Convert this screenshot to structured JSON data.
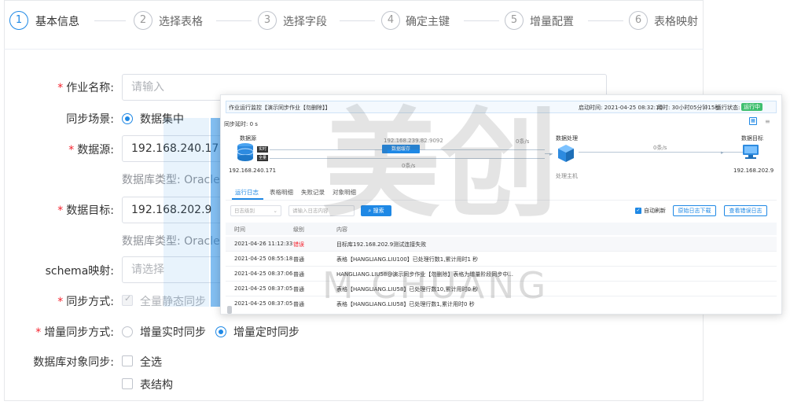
{
  "steps": [
    {
      "num": "1",
      "label": "基本信息"
    },
    {
      "num": "2",
      "label": "选择表格"
    },
    {
      "num": "3",
      "label": "选择字段"
    },
    {
      "num": "4",
      "label": "确定主键"
    },
    {
      "num": "5",
      "label": "增量配置"
    },
    {
      "num": "6",
      "label": "表格映射"
    }
  ],
  "form": {
    "job_name": {
      "label": "作业名称:",
      "placeholder": "请输入"
    },
    "scene": {
      "label": "同步场景:",
      "option": "数据集中"
    },
    "source": {
      "label": "数据源:",
      "value": "192.168.240.171",
      "db_type": "数据库类型: Oracle"
    },
    "target": {
      "label": "数据目标:",
      "value": "192.168.202.9",
      "db_type": "数据库类型: Oracle"
    },
    "schema": {
      "label": "schema映射:",
      "placeholder": "请选择"
    },
    "sync_mode": {
      "label": "同步方式:",
      "option": "全量静态同步"
    },
    "inc_mode": {
      "label": "增量同步方式:",
      "option_realtime": "增量实时同步",
      "option_scheduled": "增量定时同步"
    },
    "obj_sync": {
      "label": "数据库对象同步:",
      "select_all": "全选",
      "table_structure": "表结构"
    }
  },
  "watermark": {
    "brand_cn": "美创",
    "brand_en": "M CHUANG"
  },
  "card": {
    "title": "作业运行监控【演示同步作业【勿删除】】",
    "start_time": "启动时间: 2021-04-25 08:32:10",
    "elapsed": "用时: 30小时05分钟15秒",
    "status_label": "运行状态:",
    "status": "运行中",
    "delay": "同步延时: 0 s",
    "flow": {
      "source_title": "数据源",
      "source_ip": "192.168.240.171",
      "tag_realtime": "实时",
      "tag_full": "全量",
      "cache_ip": "192.168.239.82:9092",
      "cache_label": "数据缓存",
      "rate1": "0条/s",
      "rate2": "0条/s",
      "rate3": "0条/s",
      "proc_title": "数据处理",
      "proc_host": "处理主机",
      "target_title": "数据目标",
      "target_ip": "192.168.202.9"
    },
    "tabs": [
      "运行日志",
      "表格明细",
      "失败记录",
      "对象明细"
    ],
    "filter": {
      "level_placeholder": "日志级别",
      "content_placeholder": "请输入日志内容",
      "search": "搜索",
      "auto_refresh": "自动刷新",
      "download": "原始日志下载",
      "error_log": "查看错误日志"
    },
    "table": {
      "headers": [
        "时间",
        "级别",
        "内容"
      ],
      "rows": [
        {
          "time": "2021-04-26 11:12:33",
          "level": "错误",
          "content": "目标库192.168.202.9测试连接失败"
        },
        {
          "time": "2021-04-25 08:55:18",
          "level": "普通",
          "content": "表格【HANGLIANG.LIU100】已处理行数1,累计用时1 秒"
        },
        {
          "time": "2021-04-25 08:37:06",
          "level": "普通",
          "content": "HANGLIANG.LIU58@演示同步作业【勿删除】表格为增量阶段同步中..."
        },
        {
          "time": "2021-04-25 08:37:05",
          "level": "普通",
          "content": "表格【HANGLIANG.LIU58】已处理行数10,累计用时0 秒"
        },
        {
          "time": "2021-04-25 08:37:05",
          "level": "普通",
          "content": "表格【HANGLIANG.LIU58】已处理行数1,累计用时0 秒"
        }
      ]
    }
  },
  "colors": {
    "accent": "#1e88e5",
    "required": "#f5222d",
    "running": "#3fbf6f"
  }
}
